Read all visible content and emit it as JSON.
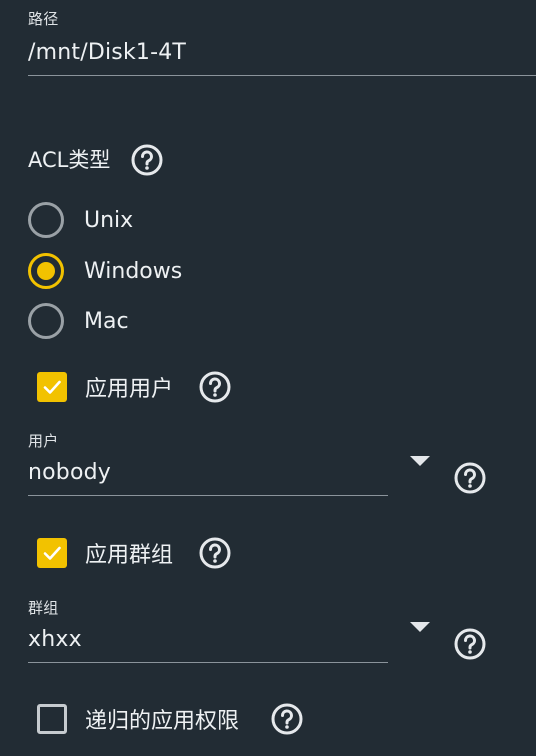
{
  "path": {
    "label": "路径",
    "value": "/mnt/Disk1-4T"
  },
  "acl": {
    "title": "ACL类型",
    "help_icon": "help-circle-icon",
    "options": [
      {
        "label": "Unix",
        "checked": false
      },
      {
        "label": "Windows",
        "checked": true
      },
      {
        "label": "Mac",
        "checked": false
      }
    ]
  },
  "apply_user": {
    "label": "应用用户",
    "checked": true,
    "help_icon": "help-circle-icon"
  },
  "user": {
    "label": "用户",
    "value": "nobody",
    "dropdown_icon": "caret-down-icon",
    "help_icon": "help-circle-icon"
  },
  "apply_group": {
    "label": "应用群组",
    "checked": true,
    "help_icon": "help-circle-icon"
  },
  "group": {
    "label": "群组",
    "value": "xhxx",
    "dropdown_icon": "caret-down-icon",
    "help_icon": "help-circle-icon"
  },
  "recursive": {
    "label": "递归的应用权限",
    "checked": false,
    "help_icon": "help-circle-icon"
  },
  "colors": {
    "background": "#222c34",
    "accent": "#f2c200",
    "text": "#eef1f3",
    "underline": "#8b949b"
  }
}
